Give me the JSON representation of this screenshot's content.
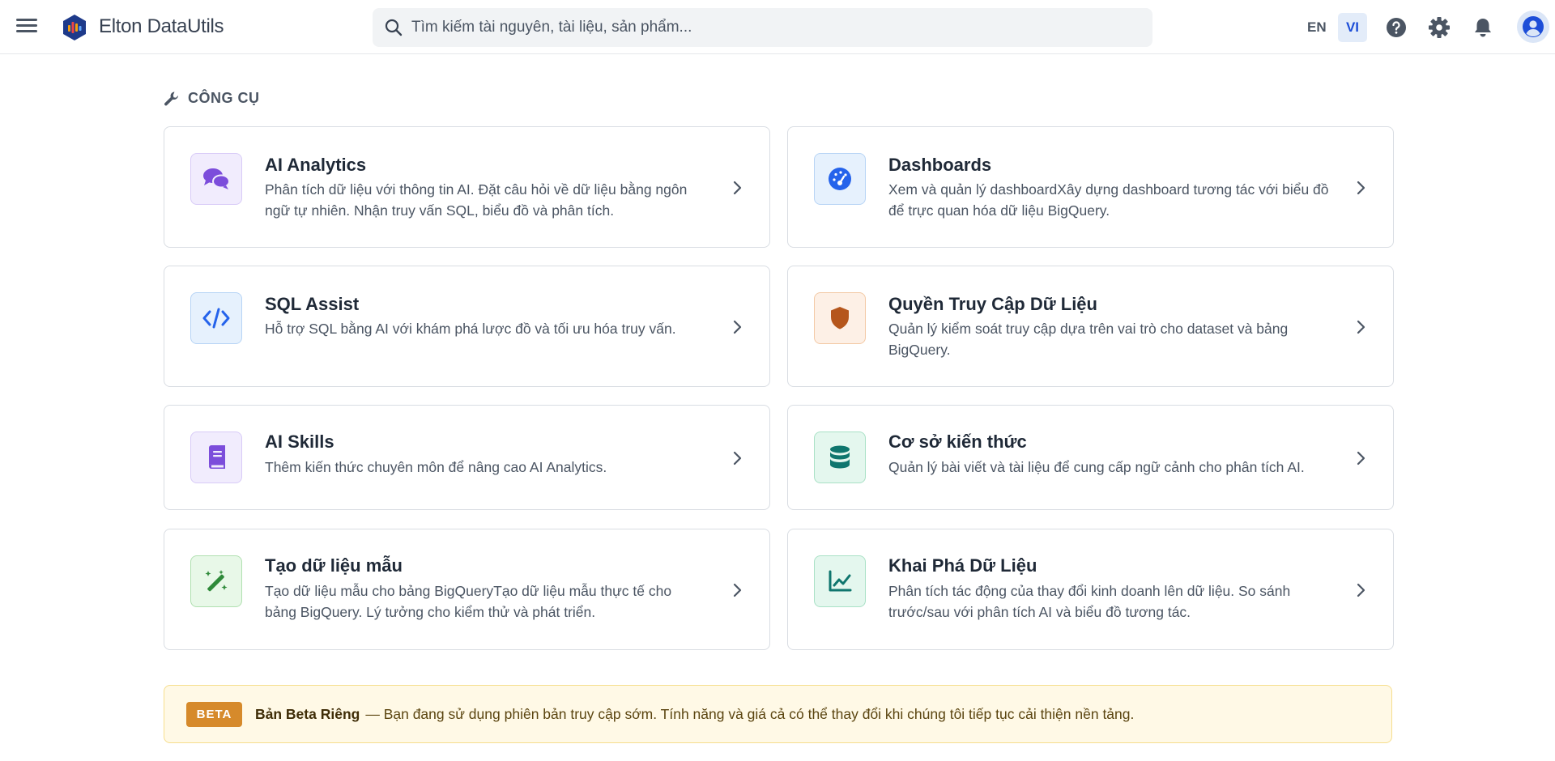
{
  "header": {
    "app_title": "Elton DataUtils",
    "search_placeholder": "Tìm kiếm tài nguyên, tài liệu, sản phẩm...",
    "lang_en": "EN",
    "lang_vi": "VI",
    "active_lang": "VI"
  },
  "section": {
    "title": "CÔNG CỤ",
    "icon": "wrench-icon"
  },
  "cards": [
    {
      "title": "AI Analytics",
      "description": "Phân tích dữ liệu với thông tin AI. Đặt câu hỏi về dữ liệu bằng ngôn ngữ tự nhiên. Nhận truy vấn SQL, biểu đồ và phân tích.",
      "icon": "chat-bubbles-icon",
      "color": "#7c4ddb"
    },
    {
      "title": "Dashboards",
      "description": "Xem và quản lý dashboardXây dựng dashboard tương tác với biểu đồ để trực quan hóa dữ liệu BigQuery.",
      "icon": "gauge-icon",
      "color": "#2563eb"
    },
    {
      "title": "SQL Assist",
      "description": "Hỗ trợ SQL bằng AI với khám phá lược đồ và tối ưu hóa truy vấn.",
      "icon": "code-icon",
      "color": "#2563eb"
    },
    {
      "title": "Quyền Truy Cập Dữ Liệu",
      "description": "Quản lý kiểm soát truy cập dựa trên vai trò cho dataset và bảng BigQuery.",
      "icon": "shield-icon",
      "color": "#b5561c"
    },
    {
      "title": "AI Skills",
      "description": "Thêm kiến thức chuyên môn để nâng cao AI Analytics.",
      "icon": "book-icon",
      "color": "#7c4ddb"
    },
    {
      "title": "Cơ sở kiến thức",
      "description": "Quản lý bài viết và tài liệu để cung cấp ngữ cảnh cho phân tích AI.",
      "icon": "database-icon",
      "color": "#0f766e"
    },
    {
      "title": "Tạo dữ liệu mẫu",
      "description": "Tạo dữ liệu mẫu cho bảng BigQueryTạo dữ liệu mẫu thực tế cho bảng BigQuery. Lý tưởng cho kiểm thử và phát triển.",
      "icon": "magic-wand-icon",
      "color": "#2f8a3a"
    },
    {
      "title": "Khai Phá Dữ Liệu",
      "description": "Phân tích tác động của thay đổi kinh doanh lên dữ liệu. So sánh trước/sau với phân tích AI và biểu đồ tương tác.",
      "icon": "line-chart-icon",
      "color": "#0f766e"
    }
  ],
  "beta": {
    "badge": "BETA",
    "title": "Bản Beta Riêng",
    "text": "— Bạn đang sử dụng phiên bản truy cập sớm. Tính năng và giá cả có thể thay đổi khi chúng tôi tiếp tục cải thiện nền tảng."
  }
}
